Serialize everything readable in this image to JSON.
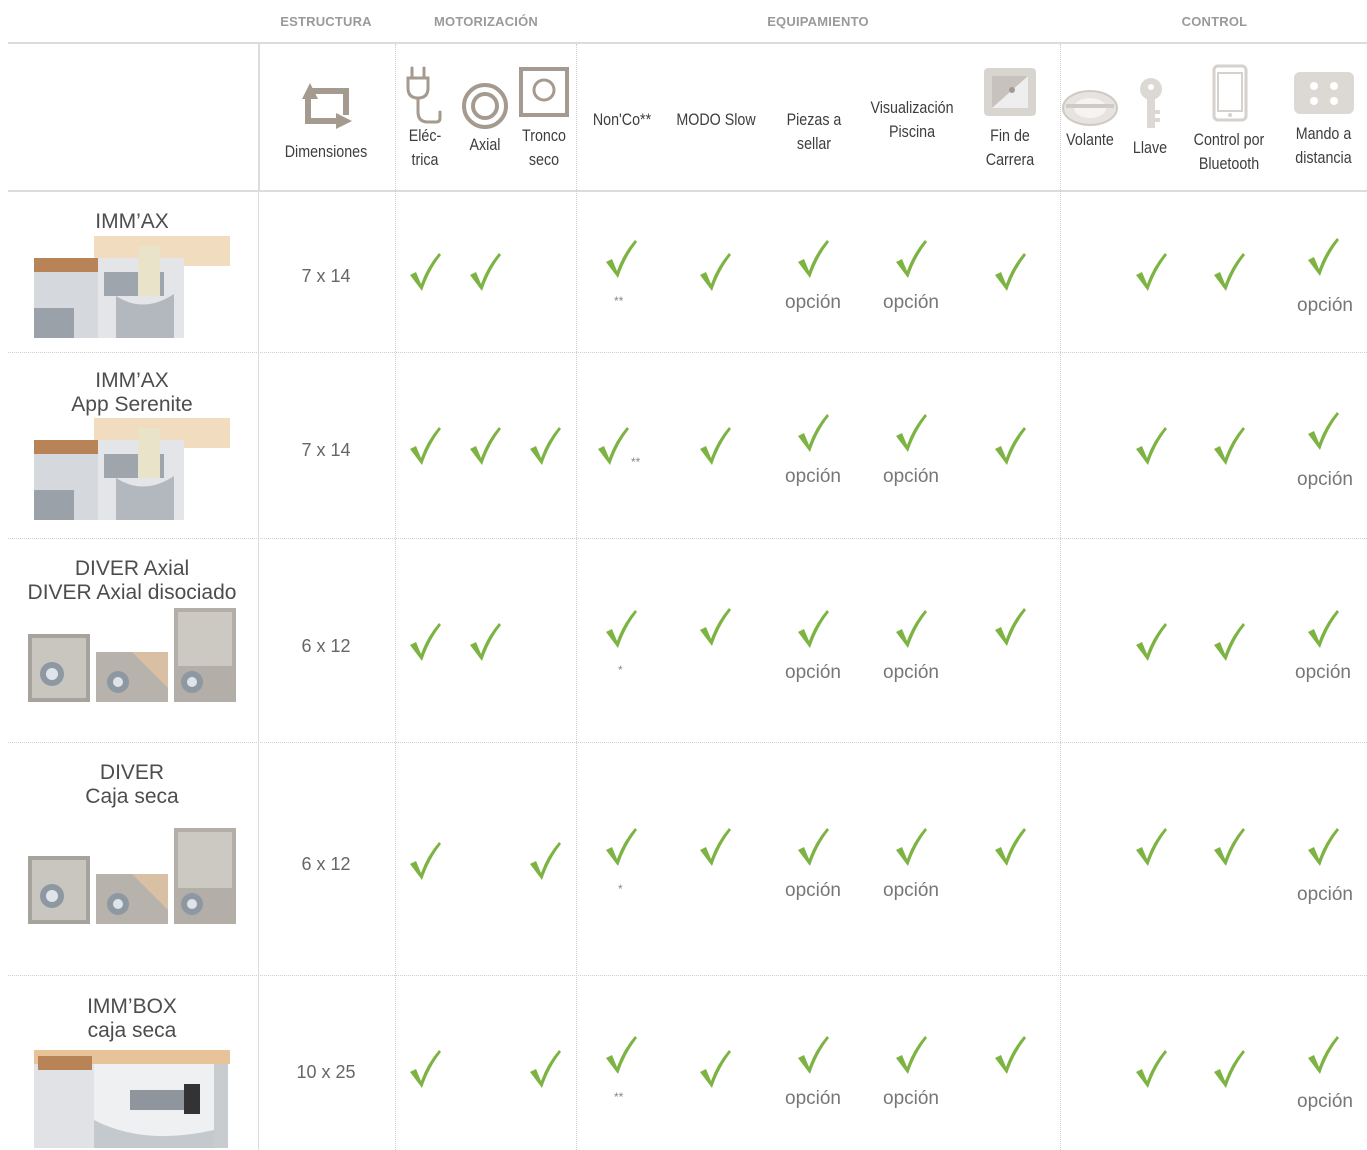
{
  "categories": {
    "estructura": "ESTRUCTURA",
    "motorizacion": "MOTORIZACIÓN",
    "equipamiento": "EQUIPAMIENTO",
    "control": "CONTROL"
  },
  "columns": {
    "dimensiones": "Dimensiones",
    "electrica_1": "Eléc-",
    "electrica_2": "trica",
    "axial": "Axial",
    "tronco_1": "Tronco",
    "tronco_2": "seco",
    "nonco": "Non'Co**",
    "modo_slow": "MODO Slow",
    "piezas_1": "Piezas a",
    "piezas_2": "sellar",
    "visual_1": "Visualización",
    "visual_2": "Piscina",
    "fin_1": "Fin de",
    "fin_2": "Carrera",
    "volante": "Volante",
    "llave": "Llave",
    "control_1": "Control por",
    "control_2": "Bluetooth",
    "mando_1": "Mando a",
    "mando_2": "distancia"
  },
  "option_label": "opción",
  "rows": [
    {
      "name_1": "IMM’AX",
      "name_2": "",
      "dimension": "7 x 14",
      "nonco_note": "**",
      "electrica": true,
      "axial": true,
      "tronco": false
    },
    {
      "name_1": "IMM’AX",
      "name_2": "App Serenite",
      "dimension": "7 x 14",
      "nonco_note": "**",
      "electrica": true,
      "axial": true,
      "tronco": true
    },
    {
      "name_1": "DIVER Axial",
      "name_2": "DIVER Axial disociado",
      "dimension": "6 x 12",
      "nonco_note": "*",
      "electrica": true,
      "axial": true,
      "tronco": false
    },
    {
      "name_1": "DIVER",
      "name_2": "Caja seca",
      "dimension": "6 x 12",
      "nonco_note": "*",
      "electrica": true,
      "axial": false,
      "tronco": true
    },
    {
      "name_1": "IMM’BOX",
      "name_2": "caja seca",
      "dimension": "10 x 25",
      "nonco_note": "**",
      "electrica": true,
      "axial": false,
      "tronco": true
    }
  ],
  "colors": {
    "check": "#7cb342",
    "divider": "#d6d6d6",
    "icon": "#a59a8f"
  }
}
